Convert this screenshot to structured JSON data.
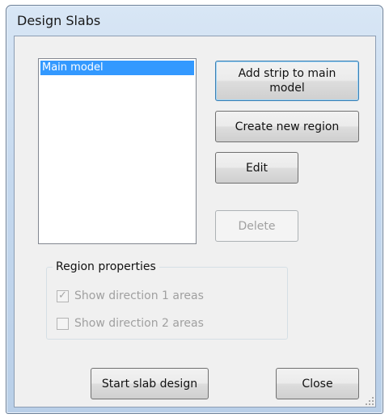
{
  "window": {
    "title": "Design Slabs"
  },
  "regions_list": {
    "items": [
      "Main model"
    ],
    "selected_index": 0
  },
  "buttons": {
    "add_strip": "Add strip to main model",
    "create_region": "Create new region",
    "edit": "Edit",
    "delete": "Delete",
    "start_design": "Start slab design",
    "close": "Close"
  },
  "region_properties": {
    "label": "Region properties",
    "show_dir1": {
      "label": "Show direction 1 areas",
      "checked": true,
      "enabled": false
    },
    "show_dir2": {
      "label": "Show direction 2 areas",
      "checked": false,
      "enabled": false
    }
  },
  "icons": {
    "checkmark": "check-icon",
    "resize": "resize-grip-icon"
  },
  "colors": {
    "selection": "#3399ff",
    "disabled_text": "#a0a0a0",
    "title_bar": "#c4d8ee"
  }
}
